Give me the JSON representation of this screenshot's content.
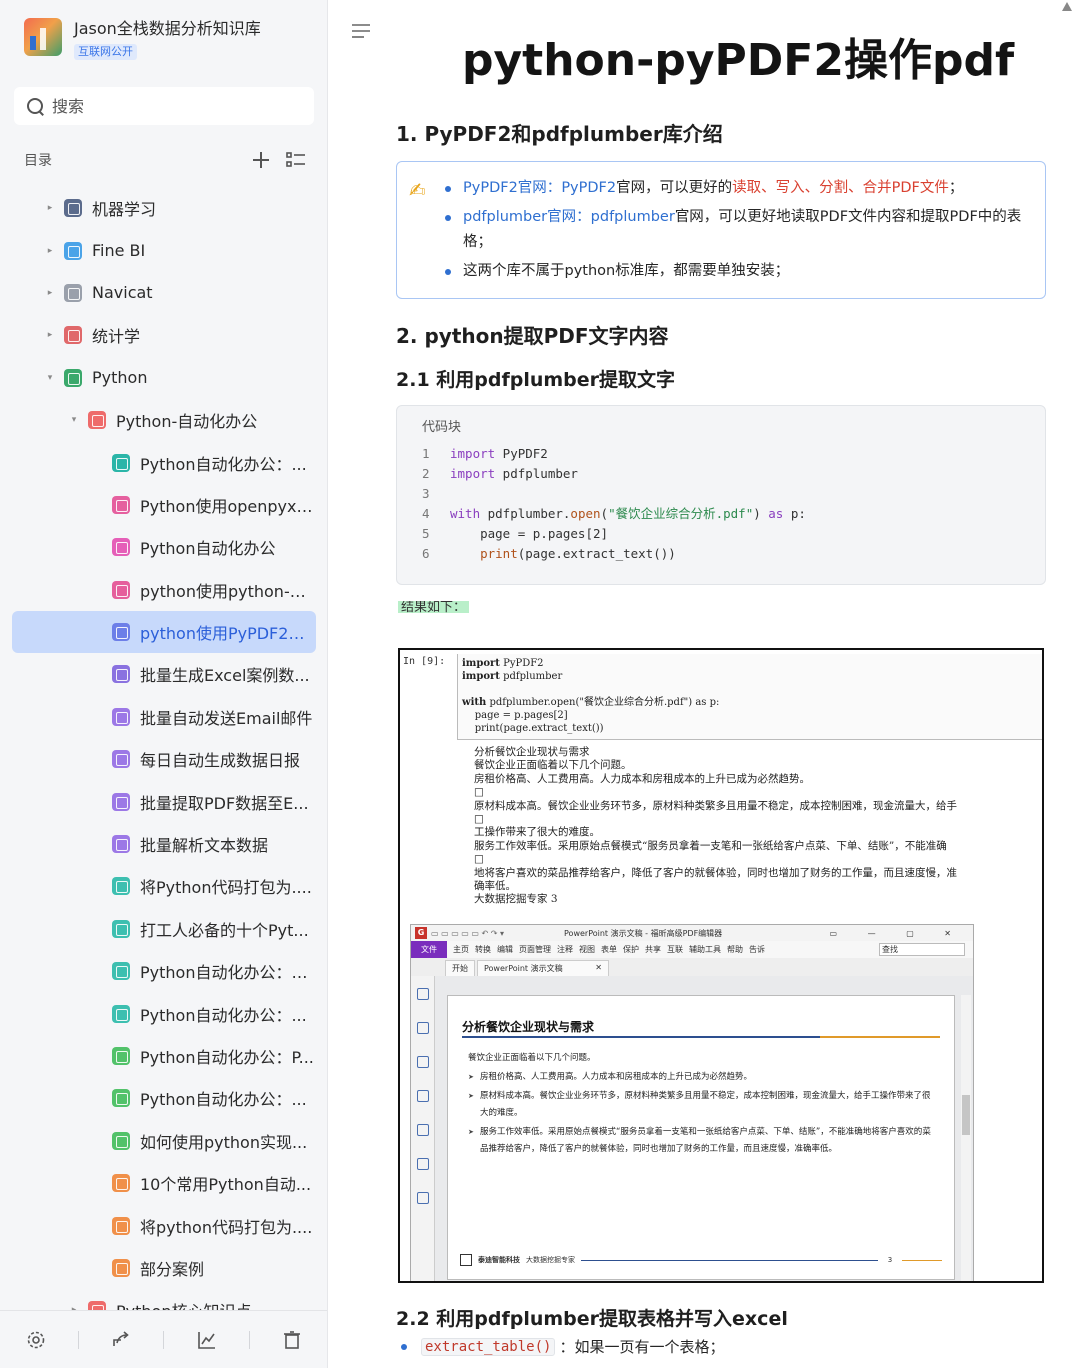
{
  "sidebar": {
    "kb_title": "Jason全栈数据分析知识库",
    "kb_badge": "互联网公开",
    "search_placeholder": "搜索",
    "toc_label": "目录",
    "items": [
      {
        "label": "机器学习",
        "caret": "▸",
        "color": "#5b6b8c"
      },
      {
        "label": "Fine BI",
        "caret": "▸",
        "color": "#4aa3e8"
      },
      {
        "label": "Navicat",
        "caret": "▸",
        "color": "#9aa0ab"
      },
      {
        "label": "统计学",
        "caret": "▸",
        "color": "#e0686a"
      },
      {
        "label": "Python",
        "caret": "▾",
        "color": "#3aa86b"
      },
      {
        "label": "Python-自动化办公",
        "caret": "▾",
        "color": "#ee6b6b"
      },
      {
        "label": "Python自动化办公：...",
        "caret": "",
        "color": "#2bb5a8"
      },
      {
        "label": "Python使用openpyxl...",
        "caret": "",
        "color": "#e5609f"
      },
      {
        "label": "Python自动化办公",
        "caret": "",
        "color": "#e55fb8"
      },
      {
        "label": "python使用python-do...",
        "caret": "",
        "color": "#e55f9c"
      },
      {
        "label": "python使用PyPDF2和...",
        "caret": "",
        "color": "#6d7fe8"
      },
      {
        "label": "批量生成Excel案例数...",
        "caret": "",
        "color": "#8a72e0"
      },
      {
        "label": "批量自动发送Email邮件",
        "caret": "",
        "color": "#9c78e6"
      },
      {
        "label": "每日自动生成数据日报",
        "caret": "",
        "color": "#9c78e6"
      },
      {
        "label": "批量提取PDF数据至E...",
        "caret": "",
        "color": "#9c78e6"
      },
      {
        "label": "批量解析文本数据",
        "caret": "",
        "color": "#9c78e6"
      },
      {
        "label": "将Python代码打包为....",
        "caret": "",
        "color": "#3dbfb0"
      },
      {
        "label": "打工人必备的十个Pyt...",
        "caret": "",
        "color": "#3dbfb0"
      },
      {
        "label": "Python自动化办公：E...",
        "caret": "",
        "color": "#3dbfb0"
      },
      {
        "label": "Python自动化办公：...",
        "caret": "",
        "color": "#3dbfb0"
      },
      {
        "label": "Python自动化办公：P...",
        "caret": "",
        "color": "#52c26a"
      },
      {
        "label": "Python自动化办公：...",
        "caret": "",
        "color": "#52c26a"
      },
      {
        "label": "如何使用python实现...",
        "caret": "",
        "color": "#52c26a"
      },
      {
        "label": "10个常用Python自动...",
        "caret": "",
        "color": "#f0904a"
      },
      {
        "label": "将python代码打包为....",
        "caret": "",
        "color": "#f0904a"
      },
      {
        "label": "部分案例",
        "caret": "",
        "color": "#f0904a"
      },
      {
        "label": "Python核心知识点",
        "caret": "▸",
        "color": "#ee6b6b"
      }
    ]
  },
  "doc": {
    "title": "python-pyPDF2操作pdf",
    "h_intro": "1. PyPDF2和pdfplumber库介绍",
    "callout": {
      "b1_link1": "PyPDF2官网：",
      "b1_link2": "PyPDF2",
      "b1_text1": "官网，可以更好的",
      "b1_red": "读取、写入、分割、合并PDF文件",
      "b1_text2": "；",
      "b2_link1": "pdfplumber官网：",
      "b2_link2": "pdfplumber",
      "b2_text": "官网，可以更好地读取PDF文件内容和提取PDF中的表格；",
      "b3_text": "这两个库不属于python标准库，都需要单独安装；"
    },
    "h_extract": "2. python提取PDF文字内容",
    "h_extract_1": "2.1 利用pdfplumber提取文字",
    "code_block_label": "代码块",
    "code_lines": [
      {
        "n": "1",
        "a": "import",
        "b": " PyPDF2"
      },
      {
        "n": "2",
        "a": "import",
        "b": " pdfplumber"
      },
      {
        "n": "3",
        "a": "",
        "b": ""
      },
      {
        "n": "4",
        "a": "with",
        "b": " pdfplumber.",
        "c": "open",
        "d": "(",
        "e": "\"餐饮企业综合分析.pdf\"",
        "f": ") ",
        "g": "as",
        "h": " p:"
      },
      {
        "n": "5",
        "a": "",
        "b": "    page = p.pages[2]"
      },
      {
        "n": "6",
        "a": "",
        "b": "    ",
        "c": "print",
        "d": "(page.extract_text())"
      }
    ],
    "result_tag": "结果如下：",
    "h_table": "2.2 利用pdfplumber提取表格并写入excel",
    "bullet_code": "extract_table()",
    "bullet_text": "：如果一页有一个表格；"
  },
  "screenshot": {
    "in_label": "In  [9]:",
    "cell_lines": [
      {
        "k": "import",
        "t": " PyPDF2"
      },
      {
        "k": "import",
        "t": " pdfplumber"
      },
      {
        "k": "",
        "t": " "
      },
      {
        "k": "with",
        "t": " pdfplumber.open(\"餐饮企业综合分析.pdf\") as p:"
      },
      {
        "k": "",
        "t": "    page = p.pages[2]"
      },
      {
        "k": "",
        "t": "    print(page.extract_text())"
      }
    ],
    "output_lines": [
      "分析餐饮企业现状与需求",
      "餐饮企业正面临着以下几个问题。",
      "房租价格高、人工费用高。人力成本和房租成本的上升已成为必然趋势。",
      "□",
      "原材料成本高。餐饮企业业务环节多，原材料种类繁多且用量不稳定，成本控制困难，现金流量大，给手",
      "□",
      "工操作带来了很大的难度。",
      "服务工作效率低。采用原始点餐模式“服务员拿着一支笔和一张纸给客户点菜、下单、结账”，不能准确",
      "□",
      "地将客户喜欢的菜品推荐给客户，降低了客户的就餐体验，同时也增加了财务的工作量，而且速度慢，准",
      "确率低。",
      "大数据挖掘专家 3"
    ],
    "ppt": {
      "logo": "G",
      "window_title": "PowerPoint 演示文稿 - 福昕高级PDF编辑器",
      "window_buttons": "▭ — ▢ ✕",
      "menu": [
        "文件",
        "主页",
        "转换",
        "编辑",
        "页面管理",
        "注释",
        "视图",
        "表单",
        "保护",
        "共享",
        "互联",
        "辅助工具",
        "帮助",
        "告诉"
      ],
      "find_placeholder": "查找",
      "tabs": [
        "开始",
        "PowerPoint 演示文稿"
      ],
      "slide_title": "分析餐饮企业现状与需求",
      "slide_intro": "餐饮企业正面临着以下几个问题。",
      "slide_bullets": [
        "房租价格高、人工费用高。人力成本和房租成本的上升已成为必然趋势。",
        "原材料成本高。餐饮企业业务环节多，原材料种类繁多且用量不稳定，成本控制困难，现金流量大，给手工操作带来了很大的难度。",
        "服务工作效率低。采用原始点餐模式“服务员拿着一支笔和一张纸给客户点菜、下单、结账”，不能准确地将客户喜欢的菜品推荐给客户，降低了客户的就餐体验，同时也增加了财务的工作量，而且速度慢，准确率低。"
      ],
      "footer_brand": "泰迪智能科技",
      "footer_sub": "大数据挖掘专家",
      "page_num": "3"
    }
  }
}
